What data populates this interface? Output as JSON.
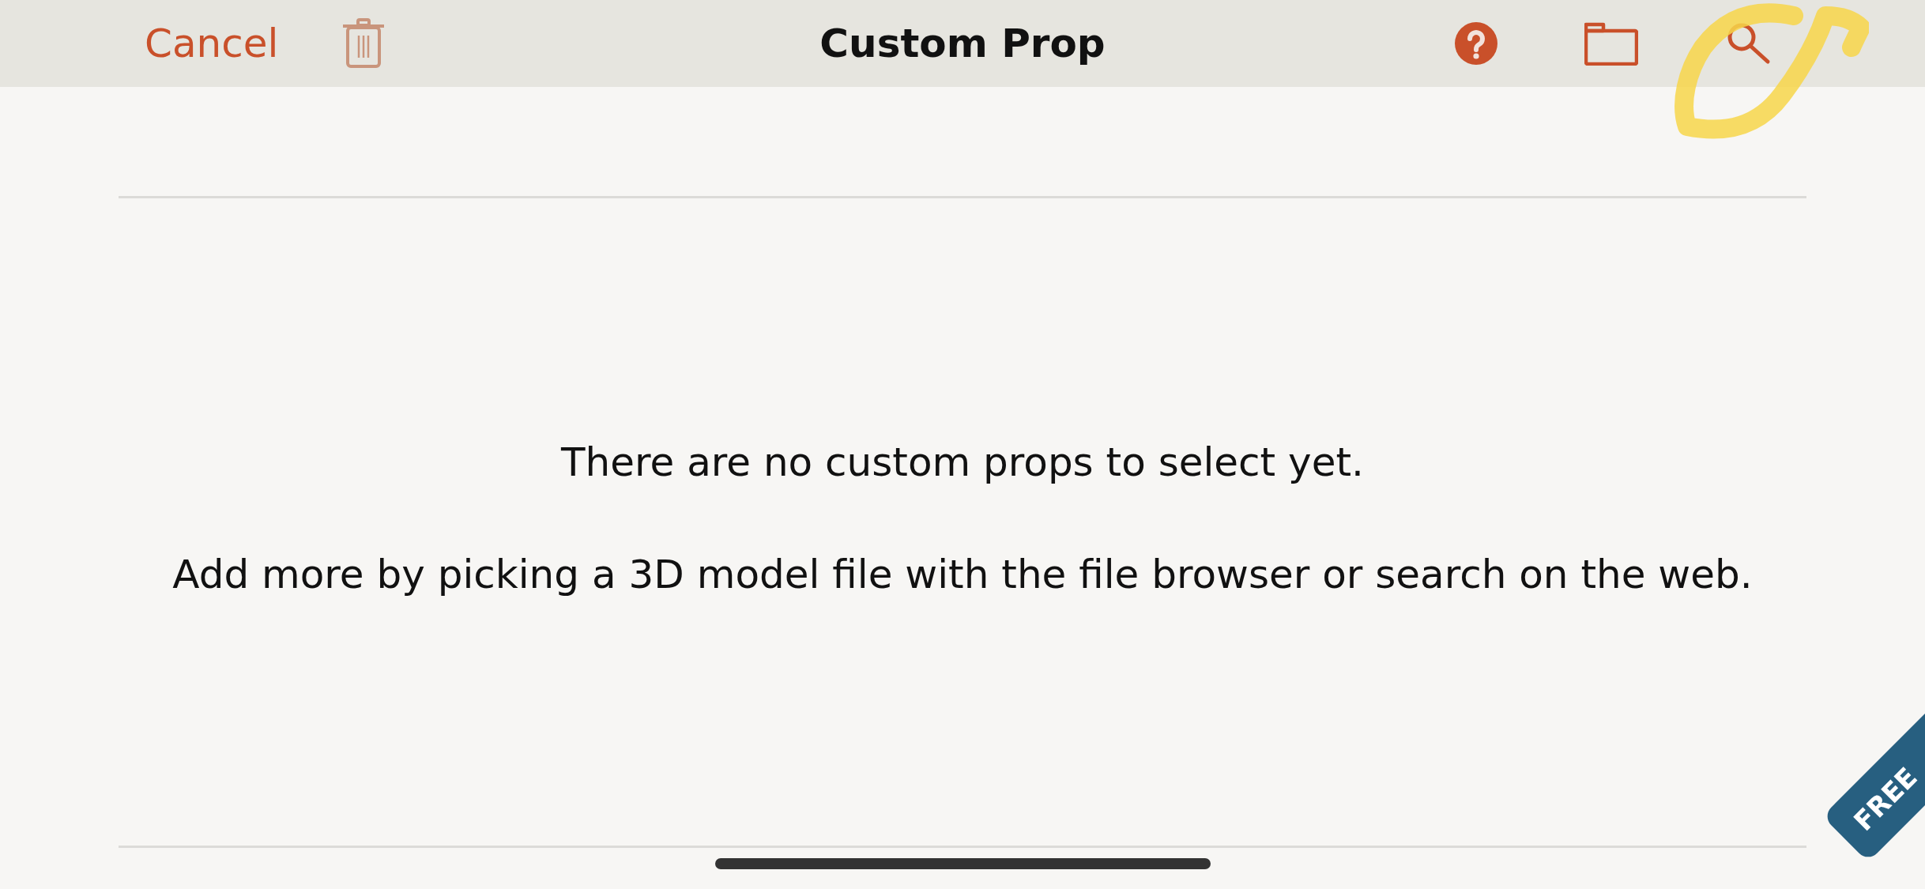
{
  "nav_bar": {
    "cancel_label": "Cancel",
    "title": "Custom Prop",
    "trash_disabled": true
  },
  "empty_state": {
    "message": "There are no custom props to select yet.",
    "hint": "Add more by picking a 3D model file with the file browser or search on the web."
  },
  "badge": {
    "label": "FREE"
  }
}
